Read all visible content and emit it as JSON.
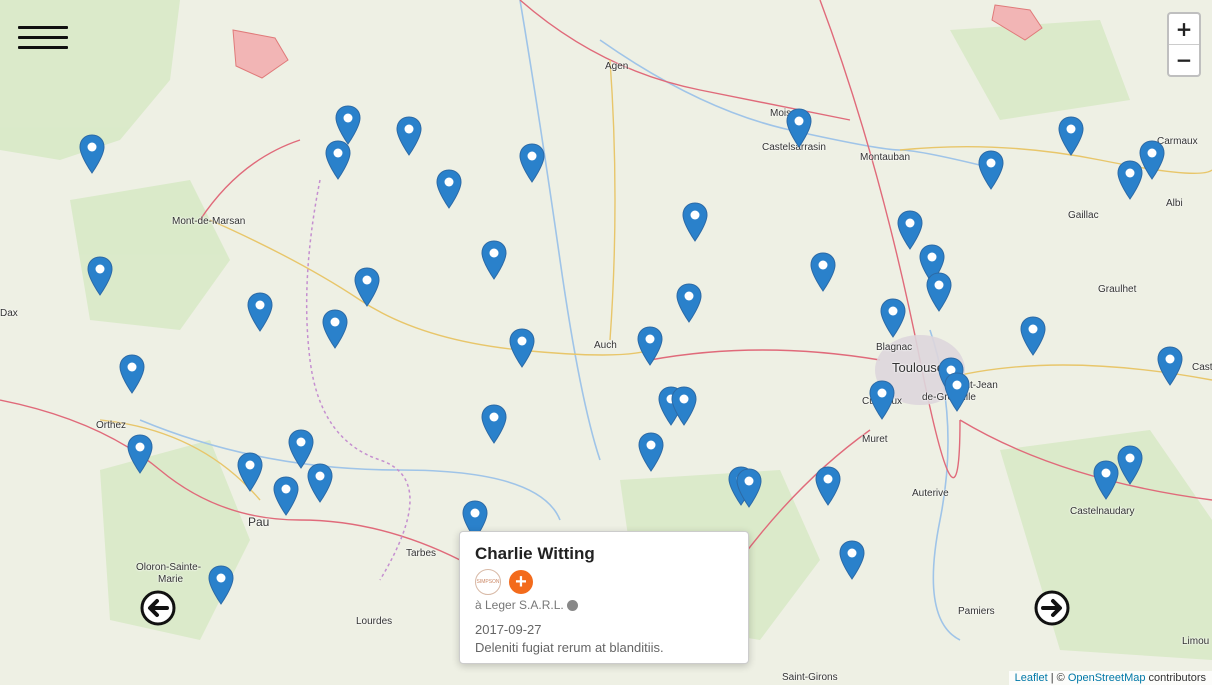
{
  "cities": [
    {
      "name": "Agen"
    },
    {
      "name": "Moissac"
    },
    {
      "name": "Castelsarrasin"
    },
    {
      "name": "Montauban"
    },
    {
      "name": "Carmaux"
    },
    {
      "name": "Gaillac"
    },
    {
      "name": "Albi"
    },
    {
      "name": "Mont-de-Marsan"
    },
    {
      "name": "Dax"
    },
    {
      "name": "Graulhet"
    },
    {
      "name": "Auch"
    },
    {
      "name": "Blagnac"
    },
    {
      "name": "Toulouse"
    },
    {
      "name": "Saint-Jean"
    },
    {
      "name": "de-Grenville"
    },
    {
      "name": "Orthez"
    },
    {
      "name": "Cugnaux"
    },
    {
      "name": "Muret"
    },
    {
      "name": "Pau"
    },
    {
      "name": "Auterive"
    },
    {
      "name": "Castelnaudary"
    },
    {
      "name": "Tarbes"
    },
    {
      "name": "Oloron-Sainte-"
    },
    {
      "name": "Marie"
    },
    {
      "name": "Lourdes"
    },
    {
      "name": "Pamiers"
    },
    {
      "name": "Saint-Girons"
    },
    {
      "name": "Limou"
    },
    {
      "name": "Cast"
    }
  ],
  "map": {
    "marker_color": "#2a81cb",
    "marker_count": 46
  },
  "controls": {
    "zoom_in": "+",
    "zoom_out": "−"
  },
  "popup": {
    "name": "Charlie Witting",
    "company": "à Leger S.A.R.L.",
    "date": "2017-09-27",
    "description": "Deleniti fugiat rerum at blanditiis.",
    "logo_text": "SIMPSON"
  },
  "attribution": {
    "leaflet": "Leaflet",
    "separator": " | © ",
    "osm": "OpenStreetMap",
    "suffix": " contributors"
  }
}
